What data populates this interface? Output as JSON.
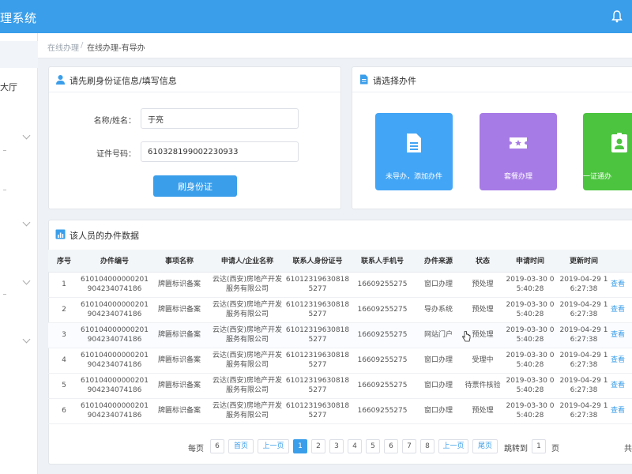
{
  "header": {
    "app_title": "理系统"
  },
  "sidebar": {
    "label": "大厅"
  },
  "breadcrumb": {
    "parent": "在线办理",
    "separator": "/",
    "current": "在线办理-有导办"
  },
  "id_panel": {
    "title": "请先刷身份证信息/填写信息",
    "name_label": "名称/姓名：",
    "name_value": "于亮",
    "id_label": "证件号码：",
    "id_value": "610328199002230933",
    "scan_button": "刷身份证"
  },
  "select_panel": {
    "title": "请选择办件",
    "tiles": [
      {
        "label": "未导办，添加办件",
        "color": "#42a5f5"
      },
      {
        "label": "套餐办理",
        "color": "#a77be6"
      },
      {
        "label": "一证通办",
        "color": "#4cc43f"
      }
    ]
  },
  "records_panel": {
    "title": "该人员的办件数据",
    "columns": [
      "序号",
      "办件编号",
      "事项名称",
      "申请人/企业名称",
      "联系人身份证号",
      "联系人手机号",
      "办件来源",
      "状态",
      "申请时间",
      "更新时间",
      ""
    ],
    "rows": [
      [
        "1",
        "610104000000201904234074186",
        "牌匾标识备案",
        "云达(西安)房地产开发服务有限公司",
        "610123196308185277",
        "16609255275",
        "窗口办理",
        "预处理",
        "2019-03-30 05:40:28",
        "2019-04-29 16:27:38",
        "查看"
      ],
      [
        "2",
        "610104000000201904234074186",
        "牌匾标识备案",
        "云达(西安)房地产开发服务有限公司",
        "610123196308185277",
        "16609255275",
        "导办系统",
        "预处理",
        "2019-03-30 05:40:28",
        "2019-04-29 16:27:38",
        "查看"
      ],
      [
        "3",
        "610104000000201904234074186",
        "牌匾标识备案",
        "云达(西安)房地产开发服务有限公司",
        "610123196308185277",
        "16609255275",
        "网站门户",
        "预处理",
        "2019-03-30 05:40:28",
        "2019-04-29 16:27:38",
        "查看"
      ],
      [
        "4",
        "610104000000201904234074186",
        "牌匾标识备案",
        "云达(西安)房地产开发服务有限公司",
        "610123196308185277",
        "16609255275",
        "窗口办理",
        "受理中",
        "2019-03-30 05:40:28",
        "2019-04-29 16:27:38",
        "查看"
      ],
      [
        "5",
        "610104000000201904234074186",
        "牌匾标识备案",
        "云达(西安)房地产开发服务有限公司",
        "610123196308185277",
        "16609255275",
        "窗口办理",
        "待票件核验",
        "2019-03-30 05:40:28",
        "2019-04-29 16:27:38",
        "查看"
      ],
      [
        "6",
        "610104000000201904234074186",
        "牌匾标识备案",
        "云达(西安)房地产开发服务有限公司",
        "610123196308185277",
        "16609255275",
        "窗口办理",
        "预处理",
        "2019-03-30 05:40:28",
        "2019-04-29 16:27:38",
        "查看"
      ]
    ]
  },
  "pagination": {
    "per_page_label": "每页",
    "per_page_value": "6",
    "first": "首页",
    "prev": "上一页",
    "pages": [
      "1",
      "2",
      "3",
      "4",
      "5",
      "6",
      "7",
      "8"
    ],
    "active_page": "1",
    "prev2": "上一页",
    "last": "尾页",
    "goto_label": "跳转到",
    "goto_value": "1",
    "page_unit": "页",
    "total_label": "共"
  },
  "colors": {
    "primary": "#3a9eea",
    "tile_blue": "#42a5f5",
    "tile_purple": "#a77be6",
    "tile_green": "#4cc43f"
  }
}
